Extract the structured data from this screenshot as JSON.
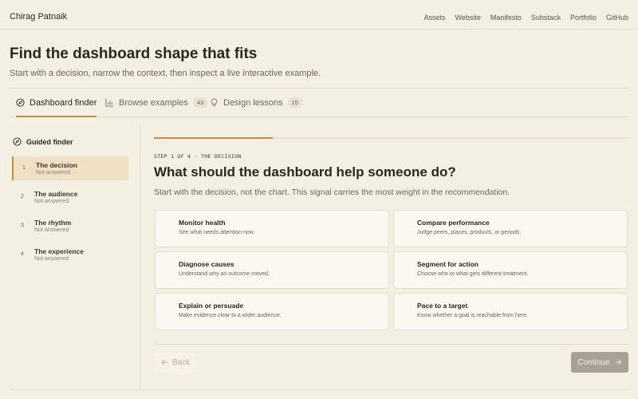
{
  "header": {
    "brand": "Chirag Patnaik",
    "nav": [
      "Assets",
      "Website",
      "Manifesto",
      "Substack",
      "Portfolio",
      "GitHub"
    ]
  },
  "hero": {
    "title": "Find the dashboard shape that fits",
    "subtitle": "Start with a decision, narrow the context, then inspect a live interactive example."
  },
  "tabs": [
    {
      "label": "Dashboard finder",
      "icon": "compass-icon",
      "active": true
    },
    {
      "label": "Browse examples",
      "icon": "bar-chart-icon",
      "count": "43"
    },
    {
      "label": "Design lessons",
      "icon": "lightbulb-icon",
      "count": "15"
    }
  ],
  "sidebar": {
    "heading": "Guided finder",
    "steps": [
      {
        "num": "1",
        "label": "The decision",
        "status": "Not answered"
      },
      {
        "num": "2",
        "label": "The audience",
        "status": "Not answered"
      },
      {
        "num": "3",
        "label": "The rhythm",
        "status": "Not answered"
      },
      {
        "num": "4",
        "label": "The experience",
        "status": "Not answered"
      }
    ]
  },
  "main": {
    "progress": 0.25,
    "step_label": "STEP 1 OF 4 · THE DECISION",
    "question": "What should the dashboard help someone do?",
    "subtitle": "Start with the decision, not the chart. This signal carries the most weight in the recommendation.",
    "options": [
      {
        "title": "Monitor health",
        "desc": "See what needs attention now."
      },
      {
        "title": "Compare performance",
        "desc": "Judge peers, places, products, or periods."
      },
      {
        "title": "Diagnose causes",
        "desc": "Understand why an outcome moved."
      },
      {
        "title": "Segment for action",
        "desc": "Choose who or what gets different treatment."
      },
      {
        "title": "Explain or persuade",
        "desc": "Make evidence clear to a wider audience."
      },
      {
        "title": "Pace to a target",
        "desc": "Know whether a goal is reachable from here."
      }
    ],
    "back_label": "Back",
    "continue_label": "Continue"
  },
  "colors": {
    "background": "#f4efe3",
    "accent": "#c98b3c",
    "active_step_bg": "#efe0c6",
    "continue_button": "#a7a295"
  }
}
